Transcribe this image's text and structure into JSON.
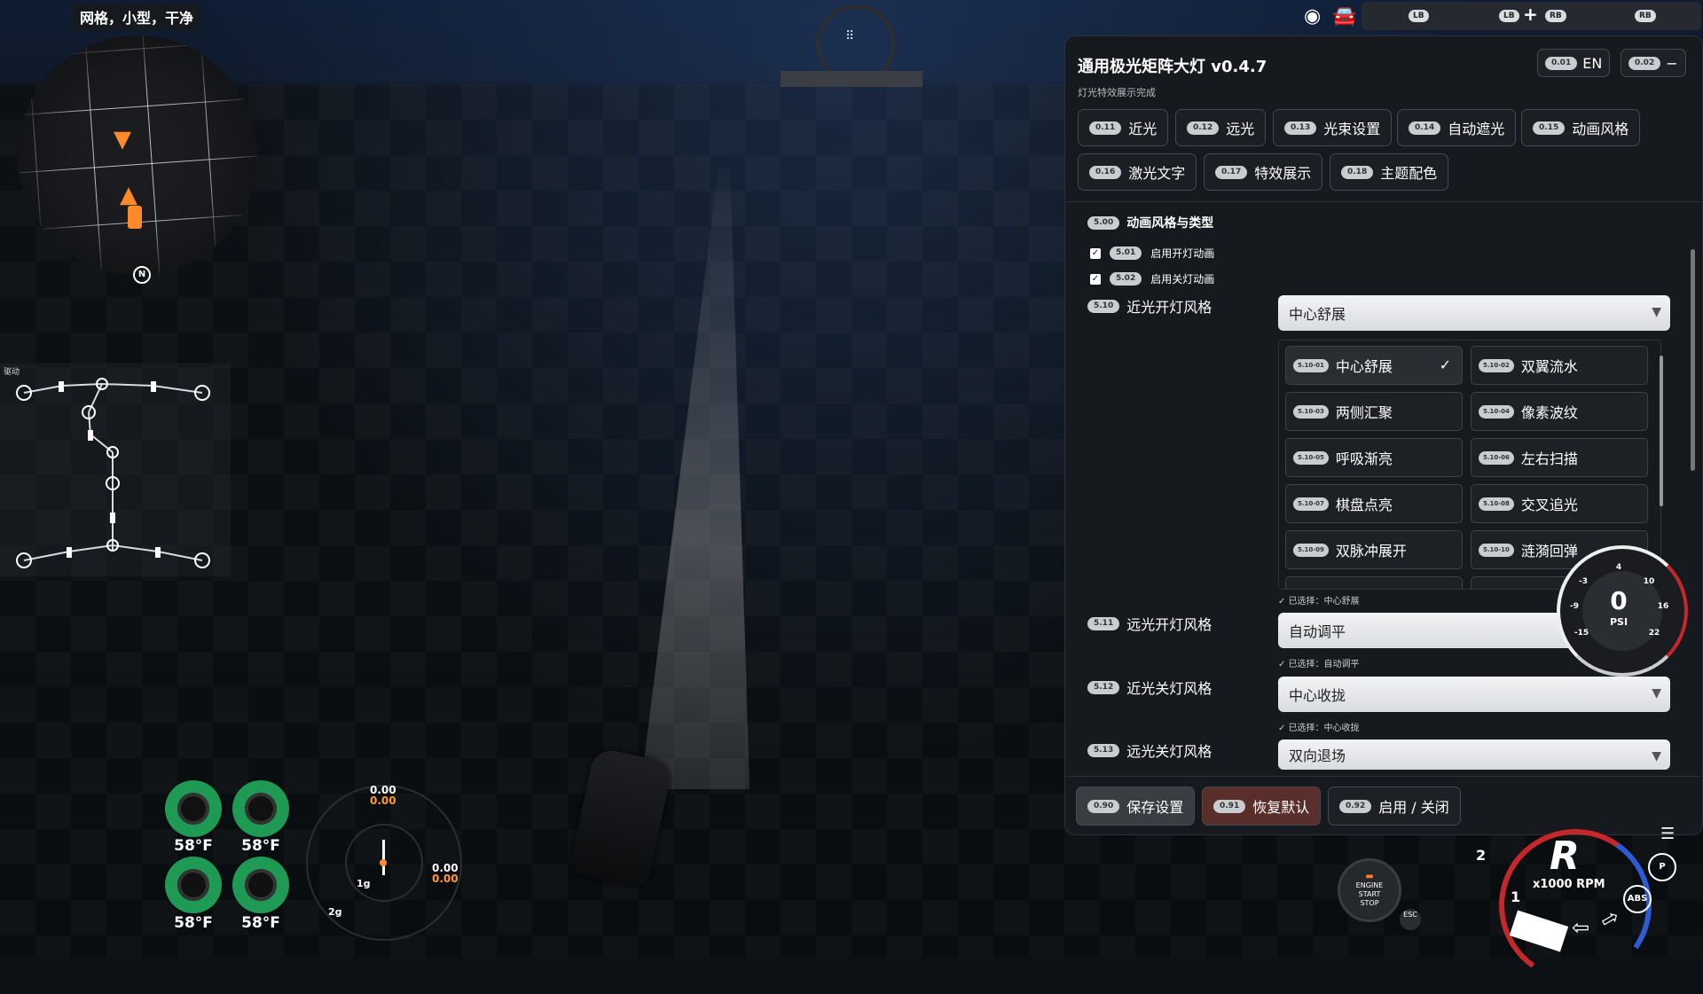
{
  "map": {
    "label": "网格，小型，干净",
    "north": "N"
  },
  "drivetrain": {
    "label": "驱动"
  },
  "tires": {
    "temps": [
      "58°F",
      "58°F",
      "58°F",
      "58°F"
    ],
    "color": "#1e9a55"
  },
  "gmeter": {
    "top_value": "0.00",
    "top_value_alt": "0.00",
    "right_value": "0.00",
    "right_value_alt": "0.00",
    "ring1": "1g",
    "ring2": "2g"
  },
  "hud_top": {
    "icons": [
      "eye-icon",
      "car-icon"
    ],
    "controller_hints": [
      "LB",
      "LB",
      "RB",
      "RB"
    ]
  },
  "panel": {
    "title": "通用极光矩阵大灯 v0.4.7",
    "status": "灯光特效展示完成",
    "lang_key": "0.01",
    "lang_label": "EN",
    "minimize_key": "0.02",
    "minimize_label": "−",
    "tabs": [
      {
        "key": "0.11",
        "label": "近光"
      },
      {
        "key": "0.12",
        "label": "远光"
      },
      {
        "key": "0.13",
        "label": "光束设置"
      },
      {
        "key": "0.14",
        "label": "自动遮光"
      },
      {
        "key": "0.15",
        "label": "动画风格"
      },
      {
        "key": "0.16",
        "label": "激光文字"
      },
      {
        "key": "0.17",
        "label": "特效展示"
      },
      {
        "key": "0.18",
        "label": "主题配色"
      }
    ],
    "section": {
      "key": "5.00",
      "title": "动画风格与类型"
    },
    "checks": [
      {
        "key": "5.01",
        "label": "启用开灯动画",
        "checked": true
      },
      {
        "key": "5.02",
        "label": "启用关灯动画",
        "checked": true
      }
    ],
    "options": [
      {
        "key": "5.10",
        "label": "近光开灯风格",
        "value": "中心舒展",
        "note": "✓ 已选择：中心舒展"
      },
      {
        "key": "5.11",
        "label": "远光开灯风格",
        "value": "自动调平",
        "note": "✓ 已选择：自动调平"
      },
      {
        "key": "5.12",
        "label": "近光关灯风格",
        "value": "中心收拢",
        "note": "✓ 已选择：中心收拢"
      },
      {
        "key": "5.13",
        "label": "远光关灯风格",
        "value": "双向退场",
        "note": ""
      }
    ],
    "list": [
      {
        "key": "5.10-01",
        "label": "中心舒展",
        "selected": true
      },
      {
        "key": "5.10-02",
        "label": "双翼流水"
      },
      {
        "key": "5.10-03",
        "label": "两侧汇聚"
      },
      {
        "key": "5.10-04",
        "label": "像素波纹"
      },
      {
        "key": "5.10-05",
        "label": "呼吸渐亮"
      },
      {
        "key": "5.10-06",
        "label": "左右扫描"
      },
      {
        "key": "5.10-07",
        "label": "棋盘点亮"
      },
      {
        "key": "5.10-08",
        "label": "交叉追光"
      },
      {
        "key": "5.10-09",
        "label": "双脉冲展开"
      },
      {
        "key": "5.10-10",
        "label": "涟漪回弹"
      }
    ],
    "footer": [
      {
        "key": "0.90",
        "label": "保存设置",
        "color": "#3a3d42"
      },
      {
        "key": "0.91",
        "label": "恢复默认",
        "color": "#5a2e2b"
      },
      {
        "key": "0.92",
        "label": "启用 / 关闭",
        "color": "#1d2024"
      }
    ]
  },
  "psi": {
    "value": "0",
    "unit": "PSI",
    "ticks": [
      "-3",
      "4",
      "10",
      "-9",
      "16",
      "-15",
      "22"
    ]
  },
  "tacho": {
    "gear": "R",
    "unit": "x1000 RPM",
    "marks": [
      "2",
      "1"
    ],
    "engine_label": [
      "ENGINE",
      "START",
      "STOP"
    ],
    "esc": "ESC",
    "parking": "P",
    "abs": "ABS"
  }
}
